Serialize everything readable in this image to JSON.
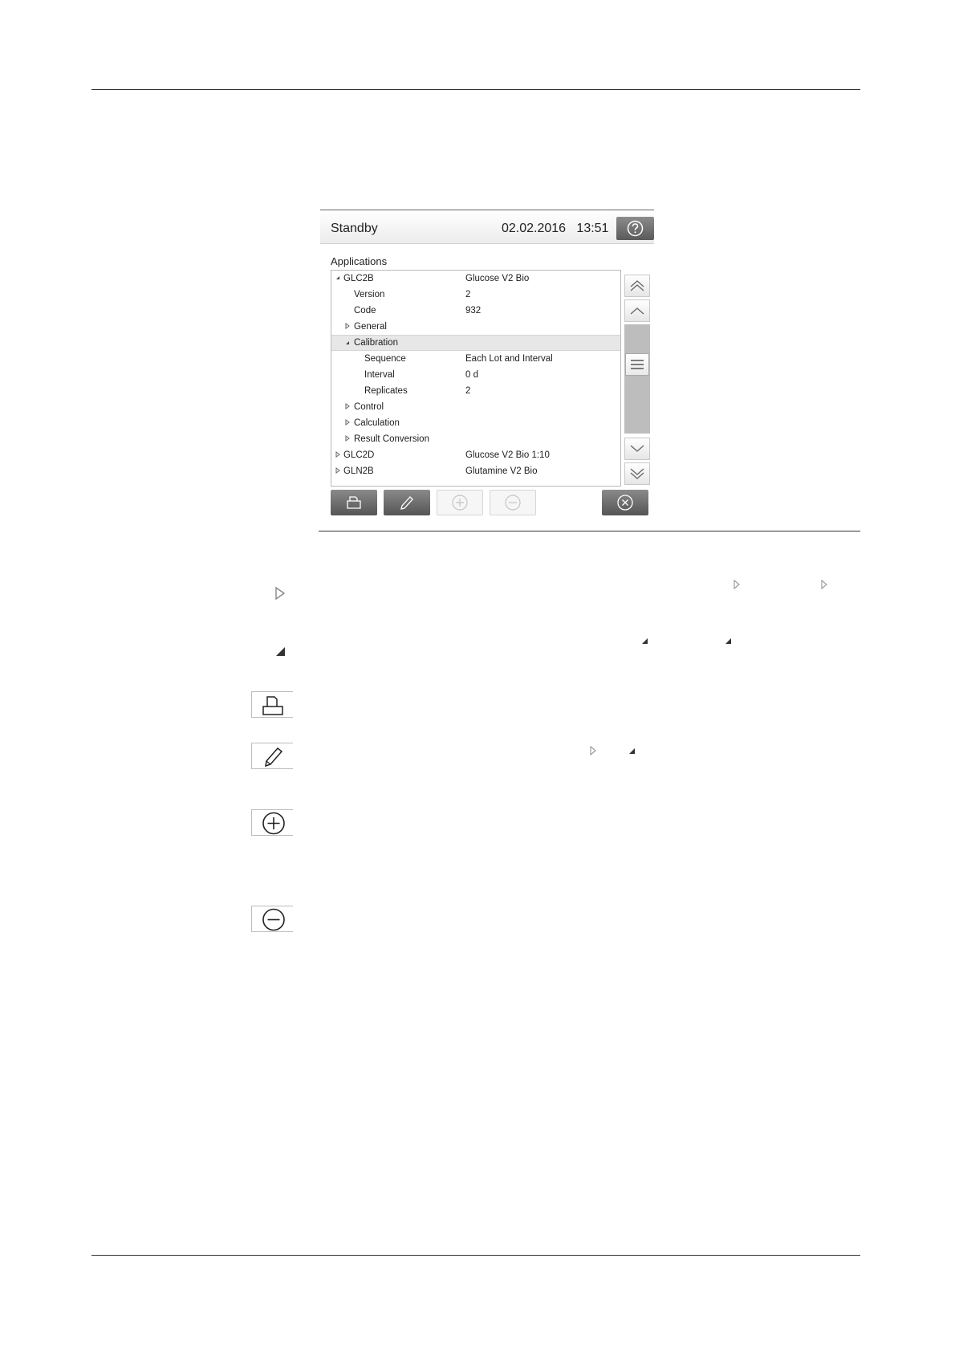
{
  "screen": {
    "status": "Standby",
    "datetime": "02.02.2016   13:51",
    "section_title": "Applications",
    "tree": [
      {
        "name": "GLC2B",
        "value": "Glucose V2 Bio",
        "level": 0,
        "state": "expanded"
      },
      {
        "name": "Version",
        "value": "2",
        "level": 1,
        "state": "leaf"
      },
      {
        "name": "Code",
        "value": "932",
        "level": 1,
        "state": "leaf"
      },
      {
        "name": "General",
        "value": "",
        "level": 1,
        "state": "collapsed"
      },
      {
        "name": "Calibration",
        "value": "",
        "level": 1,
        "state": "expanded",
        "selected": true
      },
      {
        "name": "Sequence",
        "value": "Each Lot and Interval",
        "level": 2,
        "state": "leaf"
      },
      {
        "name": "Interval",
        "value": "0 d",
        "level": 2,
        "state": "leaf"
      },
      {
        "name": "Replicates",
        "value": "2",
        "level": 2,
        "state": "leaf"
      },
      {
        "name": "Control",
        "value": "",
        "level": 1,
        "state": "collapsed"
      },
      {
        "name": "Calculation",
        "value": "",
        "level": 1,
        "state": "collapsed"
      },
      {
        "name": "Result Conversion",
        "value": "",
        "level": 1,
        "state": "collapsed"
      },
      {
        "name": "GLC2D",
        "value": "Glucose V2 Bio 1:10",
        "level": 0,
        "state": "collapsed"
      },
      {
        "name": "GLN2B",
        "value": "Glutamine V2 Bio",
        "level": 0,
        "state": "collapsed"
      }
    ],
    "icons": {
      "help": "question-icon",
      "scroll_top": "double-chevron-up-icon",
      "scroll_up": "chevron-up-icon",
      "scroll_thumb": "menu-lines-icon",
      "scroll_down": "chevron-down-icon",
      "scroll_bottom": "double-chevron-down-icon",
      "print": "print-icon",
      "edit": "pencil-icon",
      "add": "plus-circle-icon",
      "remove": "minus-circle-icon",
      "close": "close-circle-icon"
    }
  },
  "legend_icons": [
    "collapsed-triangle-icon",
    "expanded-triangle-icon",
    "print-icon",
    "pencil-icon",
    "plus-circle-icon",
    "minus-circle-icon"
  ]
}
